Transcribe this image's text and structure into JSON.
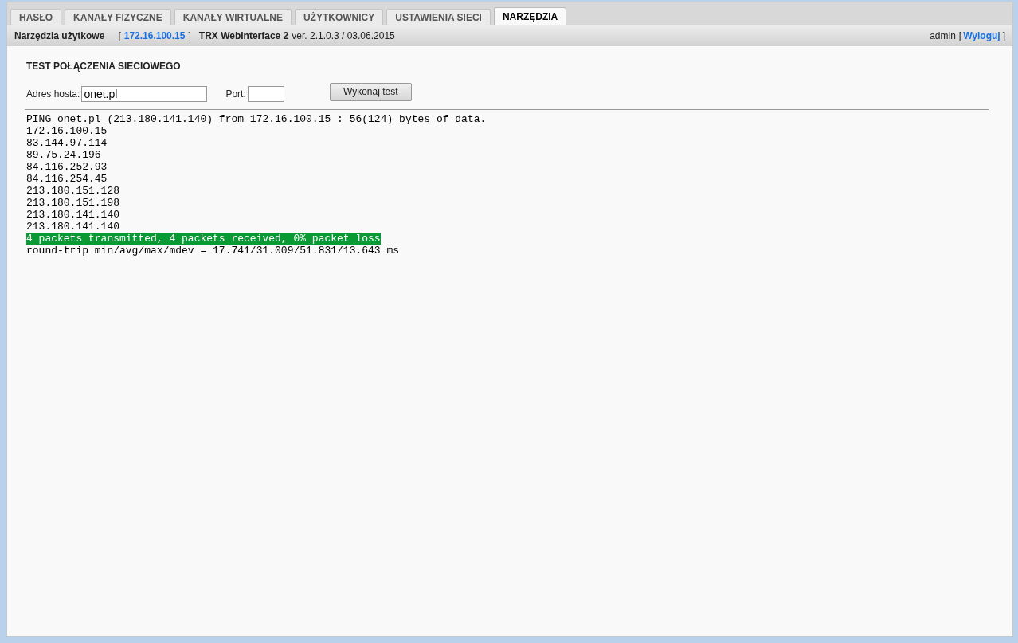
{
  "tabs": [
    {
      "label": "HASŁO",
      "selected": false
    },
    {
      "label": "KANAŁY FIZYCZNE",
      "selected": false
    },
    {
      "label": "KANAŁY WIRTUALNE",
      "selected": false
    },
    {
      "label": "UŻYTKOWNICY",
      "selected": false
    },
    {
      "label": "USTAWIENIA SIECI",
      "selected": false
    },
    {
      "label": "NARZĘDZIA",
      "selected": true
    }
  ],
  "header": {
    "section": "Narzędzia użytkowe",
    "ip_open": "[",
    "ip": "172.16.100.15",
    "ip_close": "]",
    "product": "TRX WebInterface 2",
    "version": "ver. 2.1.0.3 / 03.06.2015",
    "user": "admin",
    "logout_open": "[",
    "logout": "Wyloguj",
    "logout_close": "]"
  },
  "network_test": {
    "title": "TEST POŁĄCZENIA SIECIOWEGO",
    "host_label": "Adres hosta:",
    "host_value": "onet.pl",
    "port_label": "Port:",
    "run_button": "Wykonaj test"
  },
  "output": [
    {
      "kind": "normal",
      "text": "PING onet.pl (213.180.141.140) from 172.16.100.15 : 56(124) bytes of data."
    },
    {
      "kind": "normal",
      "text": "172.16.100.15"
    },
    {
      "kind": "normal",
      "text": "83.144.97.114"
    },
    {
      "kind": "normal",
      "text": "89.75.24.196"
    },
    {
      "kind": "normal",
      "text": "84.116.252.93"
    },
    {
      "kind": "normal",
      "text": "84.116.254.45"
    },
    {
      "kind": "normal",
      "text": "213.180.151.128"
    },
    {
      "kind": "normal",
      "text": "213.180.151.198"
    },
    {
      "kind": "normal",
      "text": "213.180.141.140"
    },
    {
      "kind": "normal",
      "text": "213.180.141.140"
    },
    {
      "kind": "highlight",
      "text": "4 packets transmitted, 4 packets received, 0% packet loss"
    },
    {
      "kind": "normal",
      "text": "round-trip min/avg/max/mdev = 17.741/31.009/51.831/13.643 ms"
    }
  ]
}
